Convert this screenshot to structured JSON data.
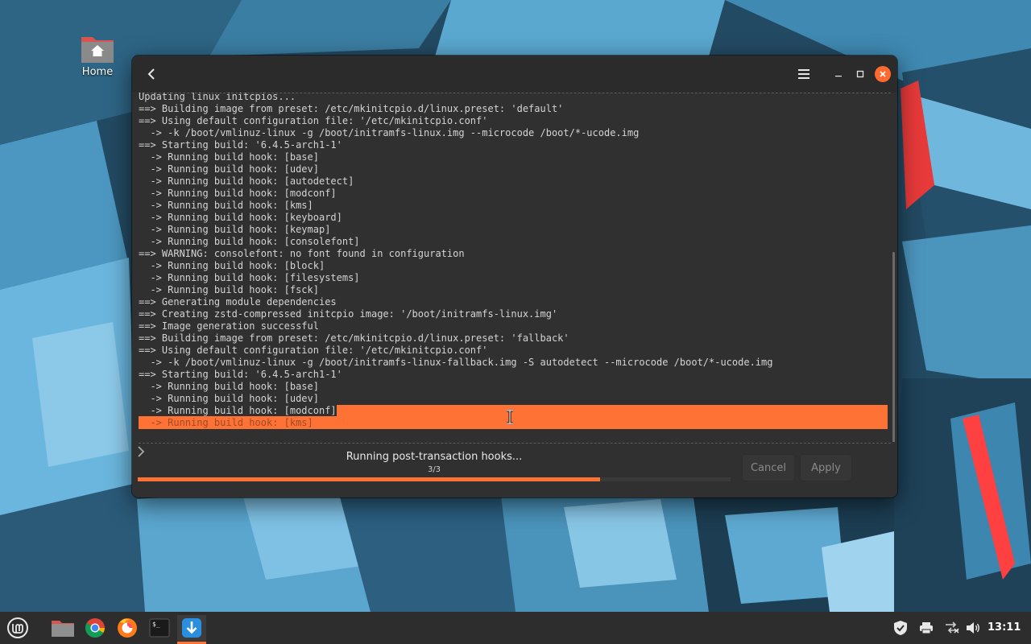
{
  "desktop": {
    "home_label": "Home"
  },
  "window": {
    "log_lines": [
      "Updating linux initcpios...",
      "==> Building image from preset: /etc/mkinitcpio.d/linux.preset: 'default'",
      "==> Using default configuration file: '/etc/mkinitcpio.conf'",
      "  -> -k /boot/vmlinuz-linux -g /boot/initramfs-linux.img --microcode /boot/*-ucode.img",
      "==> Starting build: '6.4.5-arch1-1'",
      "  -> Running build hook: [base]",
      "  -> Running build hook: [udev]",
      "  -> Running build hook: [autodetect]",
      "  -> Running build hook: [modconf]",
      "  -> Running build hook: [kms]",
      "  -> Running build hook: [keyboard]",
      "  -> Running build hook: [keymap]",
      "  -> Running build hook: [consolefont]",
      "==> WARNING: consolefont: no font found in configuration",
      "  -> Running build hook: [block]",
      "  -> Running build hook: [filesystems]",
      "  -> Running build hook: [fsck]",
      "==> Generating module dependencies",
      "==> Creating zstd-compressed initcpio image: '/boot/initramfs-linux.img'",
      "==> Image generation successful",
      "==> Building image from preset: /etc/mkinitcpio.d/linux.preset: 'fallback'",
      "==> Using default configuration file: '/etc/mkinitcpio.conf'",
      "  -> -k /boot/vmlinuz-linux -g /boot/initramfs-linux-fallback.img -S autodetect --microcode /boot/*-ucode.img",
      "==> Starting build: '6.4.5-arch1-1'",
      "  -> Running build hook: [base]",
      "  -> Running build hook: [udev]",
      "  -> Running build hook: [modconf]",
      "  -> Running build hook: [kms]"
    ],
    "status_text": "Running post-transaction hooks...",
    "progress_count": "3/3",
    "progress_fraction": 0.78,
    "cancel_label": "Cancel",
    "apply_label": "Apply",
    "accent_color": "#ff7235"
  },
  "taskbar": {
    "items": [
      "mint-menu-icon",
      "files-icon",
      "chrome-icon",
      "firefox-icon",
      "terminal-icon",
      "update-manager-icon"
    ],
    "clock": "13:11"
  }
}
